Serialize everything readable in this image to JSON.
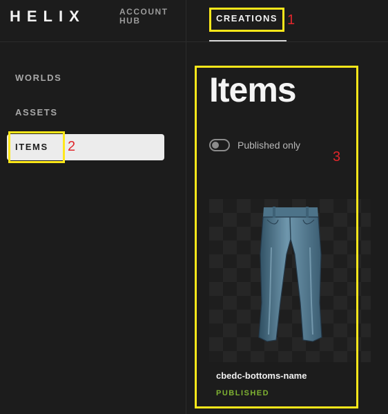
{
  "header": {
    "logo": "HELIX",
    "account_hub": "ACCOUNT HUB",
    "tab_creations": "CREATIONS"
  },
  "sidebar": {
    "items": [
      {
        "label": "WORLDS"
      },
      {
        "label": "ASSETS"
      },
      {
        "label": "ITEMS",
        "active": true
      }
    ]
  },
  "main": {
    "title": "Items",
    "toggle": {
      "label": "Published only",
      "on": false
    },
    "items": [
      {
        "name": "cbedc-bottoms-name",
        "status": "PUBLISHED",
        "thumbnail_icon": "jeans-icon"
      }
    ]
  },
  "annotations": [
    {
      "number": "1"
    },
    {
      "number": "2"
    },
    {
      "number": "3"
    }
  ],
  "colors": {
    "background": "#1c1c1c",
    "active_item_bg": "#ececec",
    "published": "#7fb332",
    "annotation_box": "#ffe81a",
    "annotation_number": "#e0262b"
  }
}
